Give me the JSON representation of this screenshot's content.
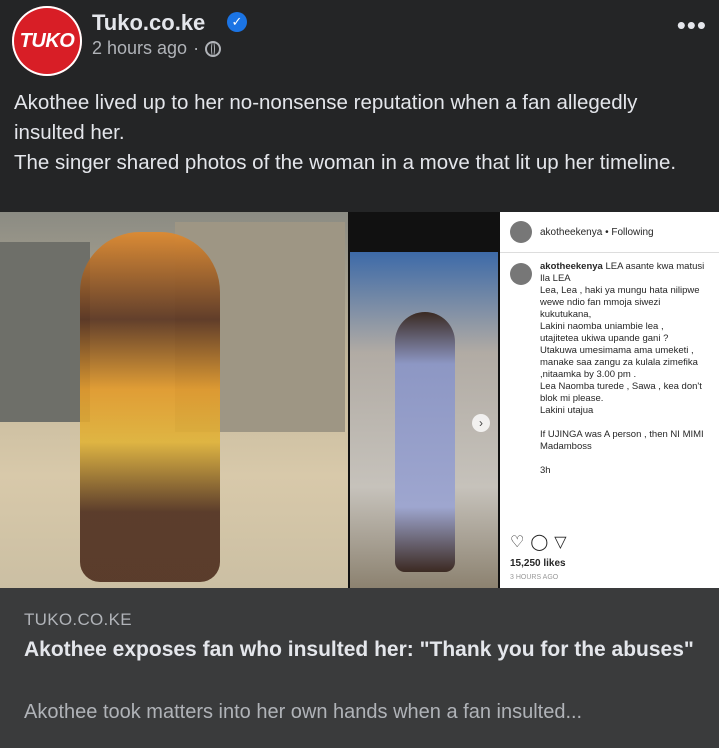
{
  "post": {
    "page_logo_text": "TUKO",
    "page_name": "Tuko.co.ke",
    "time": "2 hours ago",
    "separator": "·",
    "more_label": "•••",
    "caption_line1": "Akothee lived up to her no-nonsense reputation when a fan allegedly insulted her.",
    "caption_line2": "The singer shared photos of the woman in a move that lit up her timeline."
  },
  "instagram": {
    "header_user": "akotheekenya",
    "following": "• Following",
    "user": "akotheekenya",
    "body": "LEA asante kwa matusi \nIla LEA\nLea, Lea , haki ya mungu hata nilipwe wewe ndio fan mmoja siwezi kukutukana, \nLakini naomba uniambie lea ,\nutajitetea ukiwa upande gani ?\nUtakuwa umesimama ama umeketi ,\nmanake saa zangu za kulala zimefika ,nitaamka by 3.00 pm .\nLea Naomba turede , Sawa , kea don't blok mi please.\nLakini utajua\n\nIf UJINGA was A person , then NI MIMI Madamboss\n\n3h",
    "likes": "15,250 likes",
    "ago": "3 HOURS AGO"
  },
  "link": {
    "domain": "TUKO.CO.KE",
    "title": "Akothee exposes fan who insulted her: \"Thank you for the abuses\"",
    "description": "Akothee took matters into her own hands when a fan insulted..."
  }
}
